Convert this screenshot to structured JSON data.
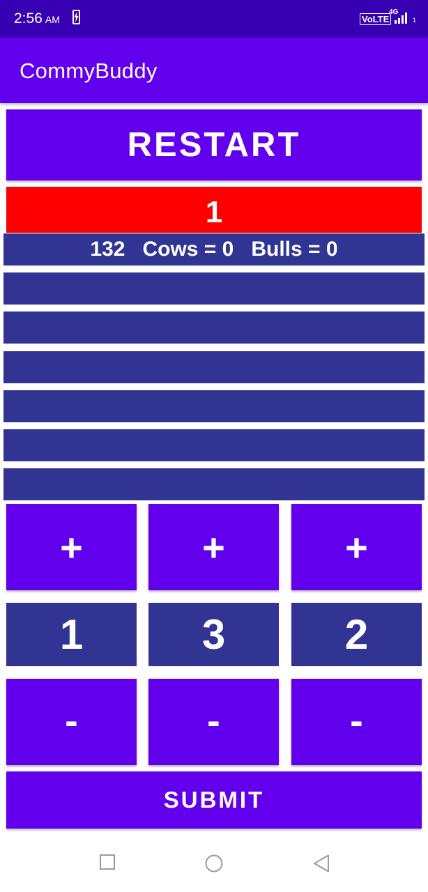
{
  "status_bar": {
    "time": "2:56",
    "ampm": "AM",
    "volte": "VoLTE",
    "network": "4G",
    "sim": "1",
    "icons": [
      "charging-battery-icon",
      "signal-icon"
    ]
  },
  "app_bar": {
    "title": "CommyBuddy"
  },
  "restart_label": "RESTART",
  "attempt_counter": "1",
  "history": [
    "132   Cows = 0   Bulls = 0",
    "",
    "",
    "",
    "",
    "",
    ""
  ],
  "pickers": {
    "increment_label": "+",
    "decrement_label": "-",
    "digits": [
      "1",
      "3",
      "2"
    ]
  },
  "submit_label": "SUBMIT",
  "nav_bar": {
    "icons": [
      "recents-square-icon",
      "home-circle-icon",
      "back-triangle-icon"
    ]
  },
  "colors": {
    "status_bar": "#3700b3",
    "primary": "#6200ee",
    "row_blue": "#323494",
    "counter_red": "#ff0000"
  }
}
